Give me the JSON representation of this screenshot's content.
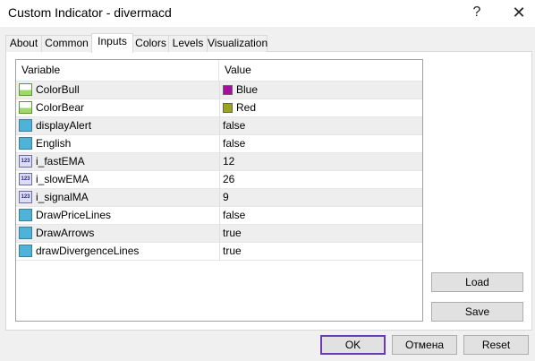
{
  "window": {
    "title": "Custom Indicator - divermacd",
    "help_glyph": "?",
    "close_glyph": "✕"
  },
  "tabs": [
    {
      "label": "About",
      "active": false
    },
    {
      "label": "Common",
      "active": false
    },
    {
      "label": "Inputs",
      "active": true
    },
    {
      "label": "Colors",
      "active": false
    },
    {
      "label": "Levels",
      "active": false
    },
    {
      "label": "Visualization",
      "active": false
    }
  ],
  "grid": {
    "columns": {
      "variable": "Variable",
      "value": "Value"
    },
    "rows": [
      {
        "variable": "ColorBull",
        "value": "Blue",
        "type": "color",
        "icon": "color-icon",
        "swatch": "#a4109e"
      },
      {
        "variable": "ColorBear",
        "value": "Red",
        "type": "color",
        "icon": "color-icon",
        "swatch": "#9aa51c"
      },
      {
        "variable": "displayAlert",
        "value": "false",
        "type": "bool",
        "icon": "bool-icon"
      },
      {
        "variable": "English",
        "value": "false",
        "type": "bool",
        "icon": "bool-icon"
      },
      {
        "variable": "i_fastEMA",
        "value": "12",
        "type": "int",
        "icon": "int-icon",
        "icon_text": "123"
      },
      {
        "variable": "i_slowEMA",
        "value": "26",
        "type": "int",
        "icon": "int-icon",
        "icon_text": "123"
      },
      {
        "variable": "i_signalMA",
        "value": "9",
        "type": "int",
        "icon": "int-icon",
        "icon_text": "123"
      },
      {
        "variable": "DrawPriceLines",
        "value": "false",
        "type": "bool",
        "icon": "bool-icon"
      },
      {
        "variable": "DrawArrows",
        "value": "true",
        "type": "bool",
        "icon": "bool-icon"
      },
      {
        "variable": "drawDivergenceLines",
        "value": "true",
        "type": "bool",
        "icon": "bool-icon"
      }
    ]
  },
  "buttons": {
    "load": "Load",
    "save": "Save",
    "ok": "OK",
    "cancel": "Отмена",
    "reset": "Reset"
  }
}
